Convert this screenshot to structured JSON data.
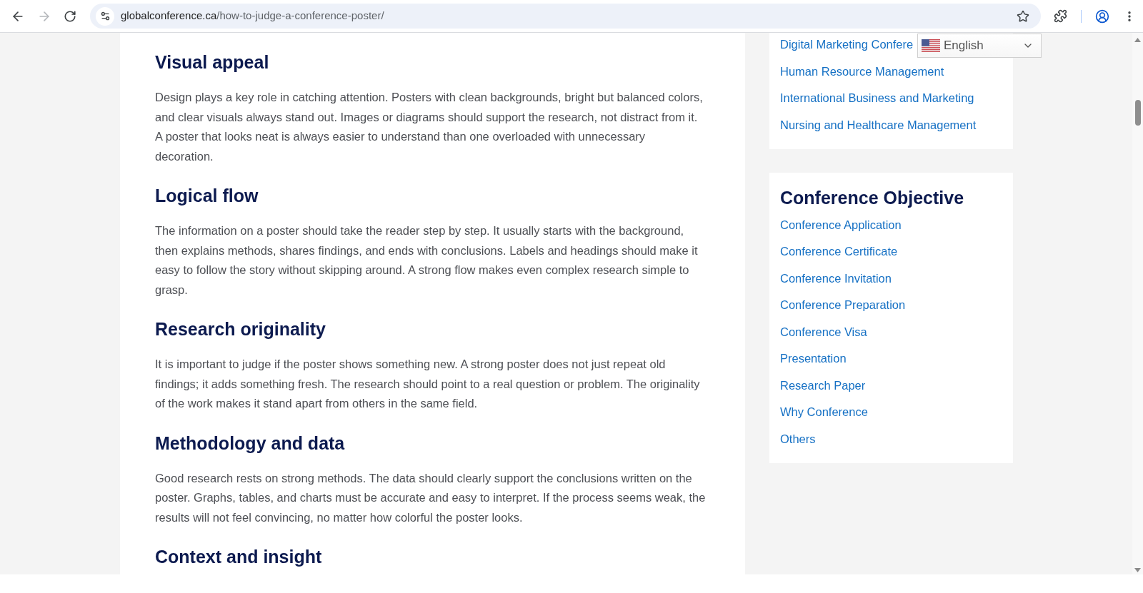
{
  "browser": {
    "forward_button": {
      "disabled": true
    },
    "url_host": "globalconference.ca",
    "url_path": "/how-to-judge-a-conference-poster/"
  },
  "article": {
    "sections": [
      {
        "heading": "Visual appeal",
        "paragraph": "Design plays a key role in catching attention. Posters with clean backgrounds, bright but balanced colors, and clear visuals always stand out. Images or diagrams should support the research, not distract from it. A poster that looks neat is always easier to understand than one overloaded with unnecessary decoration."
      },
      {
        "heading": "Logical flow",
        "paragraph": "The information on a poster should take the reader step by step. It usually starts with the background, then explains methods, shares findings, and ends with conclusions. Labels and headings should make it easy to follow the story without skipping around. A strong flow makes even complex research simple to grasp."
      },
      {
        "heading": "Research originality",
        "paragraph": "It is important to judge if the poster shows something new. A strong poster does not just repeat old findings; it adds something fresh. The research should point to a real question or problem. The originality of the work makes it stand apart from others in the same field."
      },
      {
        "heading": "Methodology and data",
        "paragraph": "Good research rests on strong methods. The data should clearly support the conclusions written on the poster. Graphs, tables, and charts must be accurate and easy to interpret. If the process seems weak, the results will not feel convincing, no matter how colorful the poster looks."
      },
      {
        "heading": "Context and insight"
      }
    ]
  },
  "sidebar": {
    "cards": [
      {
        "items": [
          "Digital Marketing Confere",
          "Human Resource Management",
          "International Business and Marketing",
          "Nursing and Healthcare Management"
        ]
      },
      {
        "title": "Conference Objective",
        "items": [
          "Conference Application",
          "Conference Certificate",
          "Conference Invitation",
          "Conference Preparation",
          "Conference Visa",
          "Presentation",
          "Research Paper",
          "Why Conference",
          "Others"
        ]
      }
    ]
  },
  "language_selector": {
    "value": "English"
  }
}
